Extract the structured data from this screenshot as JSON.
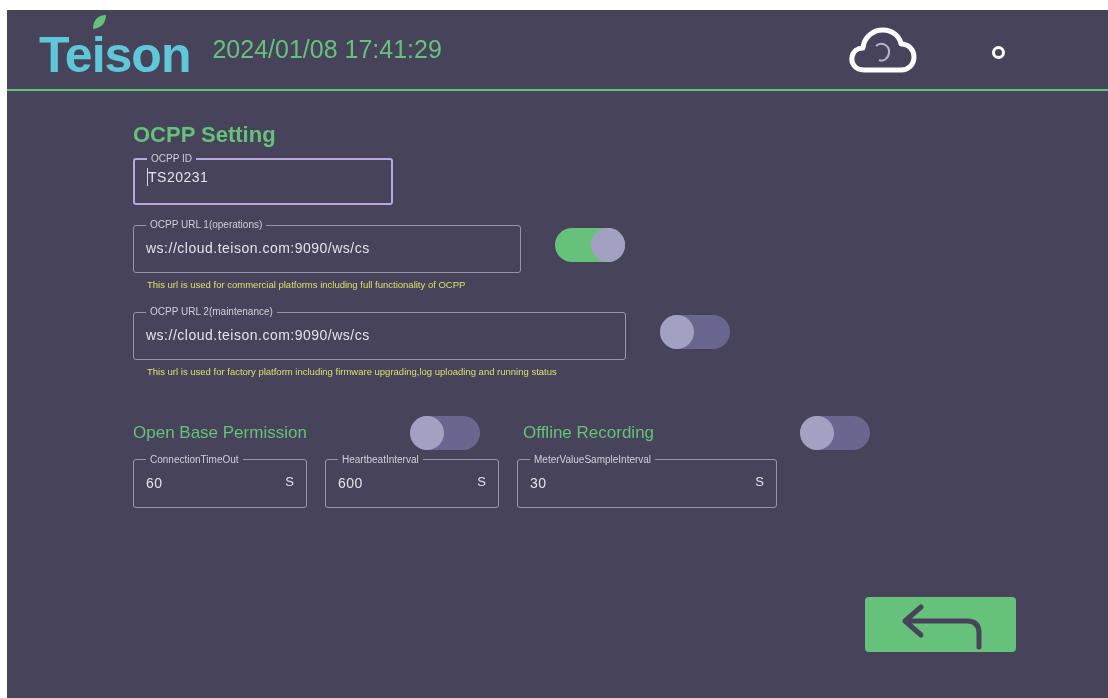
{
  "header": {
    "logo": "Teison",
    "datetime": "2024/01/08 17:41:29"
  },
  "title": "OCPP Setting",
  "id_field": {
    "label": "OCPP ID",
    "value": "TS20231",
    "focused": true
  },
  "urls": [
    {
      "label": "OCPP URL 1(operations)",
      "value": "ws://cloud.teison.com:9090/ws/cs",
      "on": true,
      "hint": "This url is used for commercial platforms including full functionality of OCPP"
    },
    {
      "label": "OCPP URL 2(maintenance)",
      "value": "ws://cloud.teison.com:9090/ws/cs",
      "on": false,
      "hint": "This url is used for factory platform including firmware upgrading,log uploading and running status"
    }
  ],
  "switches": [
    {
      "label": "Open Base Permission",
      "on": false
    },
    {
      "label": "Offline Recording",
      "on": false
    }
  ],
  "intervals": [
    {
      "label": "ConnectionTimeOut",
      "value": "60",
      "unit": "S"
    },
    {
      "label": "HeartbeatInterval",
      "value": "600",
      "unit": "S"
    },
    {
      "label": "MeterValueSampleInterval",
      "value": "30",
      "unit": "S"
    }
  ]
}
